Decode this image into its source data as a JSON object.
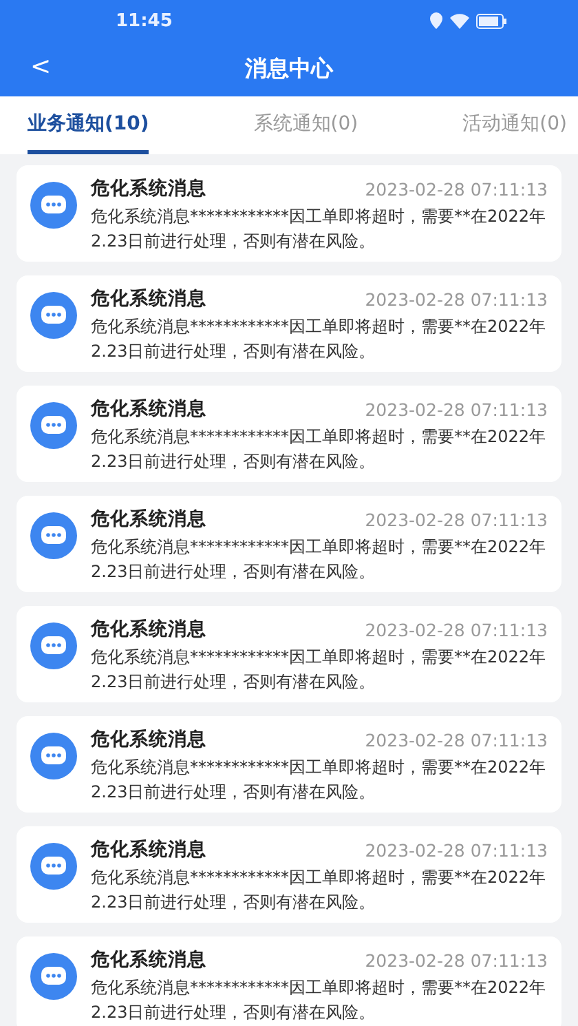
{
  "status_bar": {
    "time": "11:45"
  },
  "header": {
    "back": "<",
    "title": "消息中心"
  },
  "tabs": [
    {
      "label": "业务通知(10)",
      "selected": true
    },
    {
      "label": "系统通知(0)",
      "selected": false
    },
    {
      "label": "活动通知(0)",
      "selected": false
    }
  ],
  "messages": [
    {
      "title": "危化系统消息",
      "time": "2023-02-28 07:11:13",
      "body": "危化系统消息************因工单即将超时，需要**在2022年2.23日前进行处理，否则有潜在风险。"
    },
    {
      "title": "危化系统消息",
      "time": "2023-02-28 07:11:13",
      "body": "危化系统消息************因工单即将超时，需要**在2022年2.23日前进行处理，否则有潜在风险。"
    },
    {
      "title": "危化系统消息",
      "time": "2023-02-28 07:11:13",
      "body": "危化系统消息************因工单即将超时，需要**在2022年2.23日前进行处理，否则有潜在风险。"
    },
    {
      "title": "危化系统消息",
      "time": "2023-02-28 07:11:13",
      "body": "危化系统消息************因工单即将超时，需要**在2022年2.23日前进行处理，否则有潜在风险。"
    },
    {
      "title": "危化系统消息",
      "time": "2023-02-28 07:11:13",
      "body": "危化系统消息************因工单即将超时，需要**在2022年2.23日前进行处理，否则有潜在风险。"
    },
    {
      "title": "危化系统消息",
      "time": "2023-02-28 07:11:13",
      "body": "危化系统消息************因工单即将超时，需要**在2022年2.23日前进行处理，否则有潜在风险。"
    },
    {
      "title": "危化系统消息",
      "time": "2023-02-28 07:11:13",
      "body": "危化系统消息************因工单即将超时，需要**在2022年2.23日前进行处理，否则有潜在风险。"
    },
    {
      "title": "危化系统消息",
      "time": "2023-02-28 07:11:13",
      "body": "危化系统消息************因工单即将超时，需要**在2022年2.23日前进行处理，否则有潜在风险。"
    }
  ]
}
